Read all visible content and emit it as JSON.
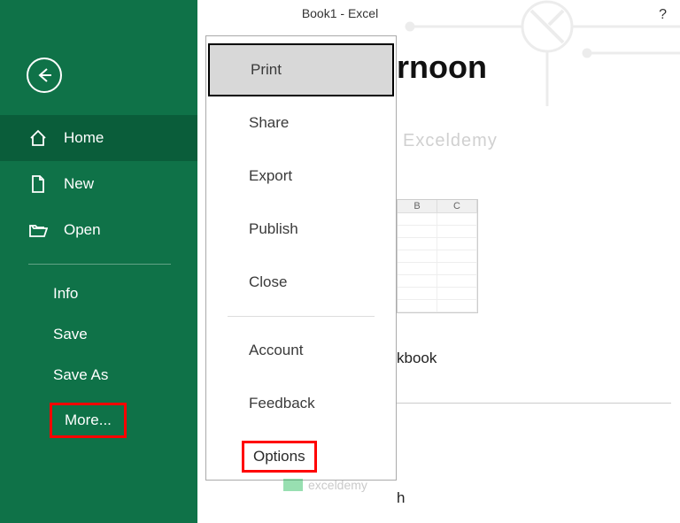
{
  "title": "Book1  -  Excel",
  "help": "?",
  "greeting_partial": "rnoon",
  "sidebar": {
    "items": [
      {
        "label": "Home"
      },
      {
        "label": "New"
      },
      {
        "label": "Open"
      }
    ],
    "sub": [
      {
        "label": "Info"
      },
      {
        "label": "Save"
      },
      {
        "label": "Save As"
      }
    ],
    "more": "More..."
  },
  "submenu": {
    "print": "Print",
    "share": "Share",
    "export": "Export",
    "publish": "Publish",
    "close": "Close",
    "account": "Account",
    "feedback": "Feedback",
    "options": "Options"
  },
  "watermark": "Exceldemy",
  "sheet": {
    "col1": "B",
    "col2": "C"
  },
  "labels": {
    "workbook": "kbook",
    "h": "h"
  },
  "footer_watermark": "exceldemy"
}
